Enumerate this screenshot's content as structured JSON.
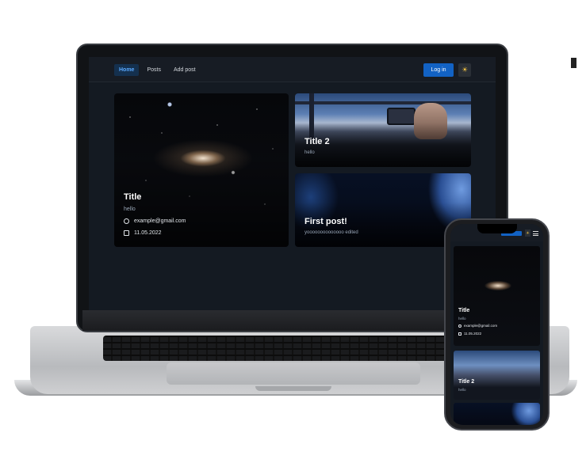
{
  "navbar": {
    "links": [
      "Home",
      "Posts",
      "Add post"
    ],
    "active_link": "Home",
    "login_label": "Log in",
    "theme_icon": "sun-icon"
  },
  "posts": [
    {
      "title": "Title",
      "subtitle": "hello",
      "email": "example@gmail.com",
      "date": "11.05.2022"
    },
    {
      "title": "Title 2",
      "subtitle": "hello"
    },
    {
      "title": "First post!",
      "subtitle": "yoooooooooooooo edited"
    }
  ],
  "colors": {
    "accent": "#1262c4",
    "background": "#141a22",
    "navbar": "#171c24",
    "active_link_text": "#5aa9ff"
  }
}
